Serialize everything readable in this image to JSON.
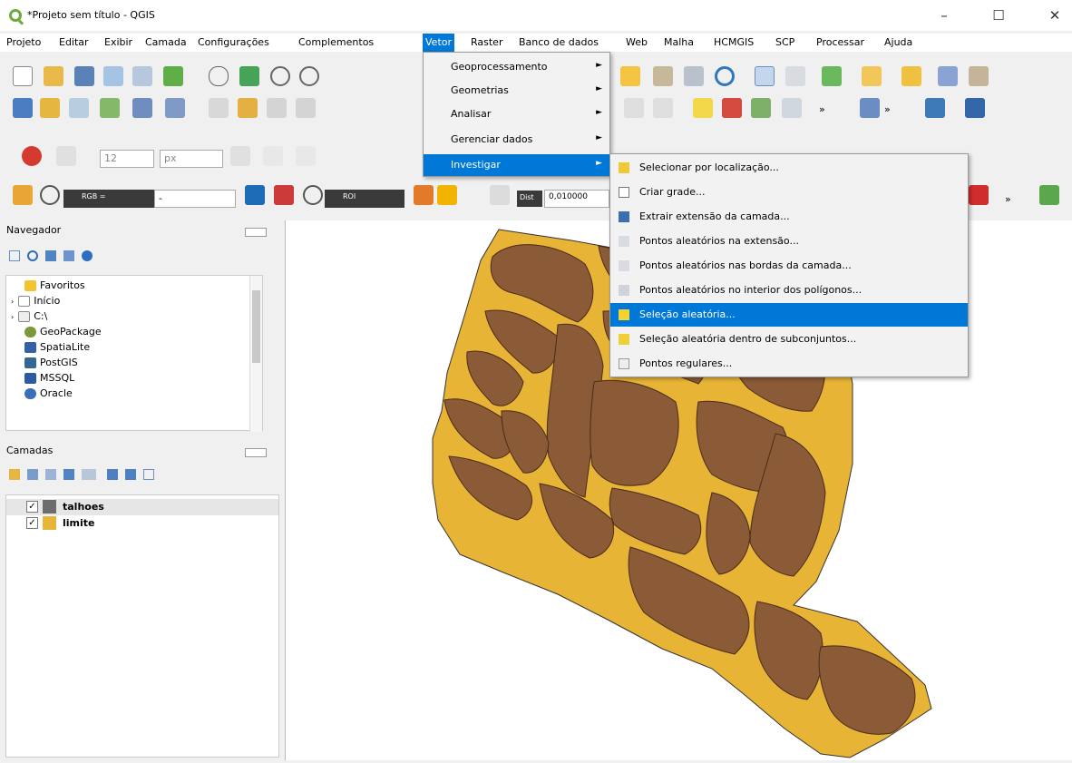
{
  "window": {
    "title": "*Projeto sem título - QGIS",
    "minimize": "–",
    "maximize": "☐",
    "close": "✕"
  },
  "menubar": [
    "Projeto",
    "Editar",
    "Exibir",
    "Camada",
    "Configurações",
    "Complementos",
    "Vetor",
    "Raster",
    "Banco de dados",
    "Web",
    "Malha",
    "HCMGIS",
    "SCP",
    "Processar",
    "Ajuda"
  ],
  "toolbar": {
    "font_size": "12",
    "unit": "px",
    "rgb": "RGB =",
    "dash": "-",
    "roi": "ROI",
    "dist_label": "Dist",
    "dist_value": "0,010000",
    "more": "»"
  },
  "navigator": {
    "title": "Navegador",
    "items": [
      "Favoritos",
      "Início",
      "C:\\",
      "GeoPackage",
      "SpatiaLite",
      "PostGIS",
      "MSSQL",
      "Oracle"
    ]
  },
  "layers_panel": {
    "title": "Camadas",
    "layers": [
      {
        "name": "talhoes",
        "color": "#6d6d6d",
        "checked": "✓"
      },
      {
        "name": "limite",
        "color": "#e6b53a",
        "checked": "✓"
      }
    ]
  },
  "vector_menu": {
    "items": [
      "Geoprocessamento",
      "Geometrias",
      "Analisar",
      "Gerenciar dados",
      "Investigar"
    ],
    "arrow": "►"
  },
  "investigate_menu": {
    "items": [
      "Selecionar por localização...",
      "Criar grade...",
      "Extrair extensão da camada...",
      "Pontos aleatórios na extensão...",
      "Pontos aleatórios nas bordas da camada...",
      "Pontos aleatórios no interior dos polígonos...",
      "Seleção aleatória...",
      "Seleção aleatória dentro de subconjuntos...",
      "Pontos regulares..."
    ],
    "selected": "Seleção aleatória..."
  },
  "colors": {
    "boundary_fill": "#e8b436",
    "plot_fill": "#8b5a36",
    "accent": "#0078d7"
  }
}
